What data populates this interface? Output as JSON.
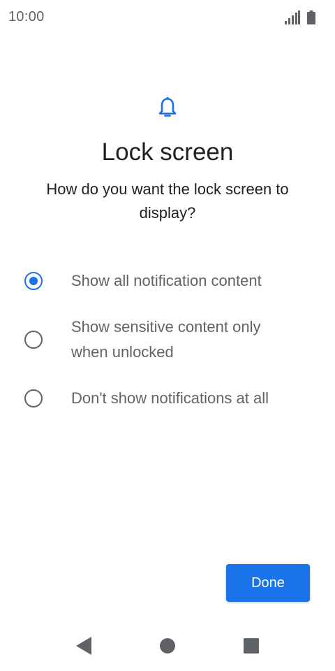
{
  "status_bar": {
    "time": "10:00",
    "icons": [
      "signal-icon",
      "battery-icon"
    ]
  },
  "header": {
    "icon": "bell-icon",
    "title": "Lock screen",
    "subtitle": "How do you want the lock screen to display?"
  },
  "options": [
    {
      "label": "Show all notification content",
      "selected": true
    },
    {
      "label": "Show sensitive content only when unlocked",
      "selected": false
    },
    {
      "label": "Don't show notifications at all",
      "selected": false
    }
  ],
  "done_button": {
    "label": "Done"
  },
  "nav_bar": {
    "icons": [
      "back-icon",
      "home-icon",
      "recents-icon"
    ]
  },
  "colors": {
    "accent": "#1a73e8",
    "text_primary": "#202124",
    "text_secondary": "#5f6368",
    "nav_icon": "#5f6368",
    "background": "#ffffff"
  }
}
